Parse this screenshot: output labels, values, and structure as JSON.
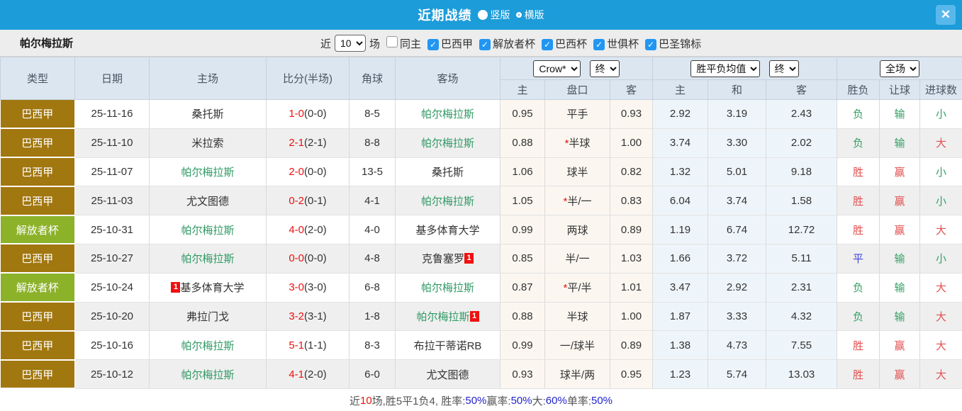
{
  "colors": {
    "header_blue": "#1c9cd9",
    "close_btn_blue": "#58b8ec",
    "checkbox_blue": "#2196f3",
    "type_gold": "#a1770f",
    "type_green": "#8cb22a",
    "team_green": "#2f9a64",
    "score_red": "#ee1111",
    "result_red": "#e25050",
    "result_green": "#35a065",
    "result_blue": "#4444dd",
    "footer_blue": "#2222cc",
    "header_row_bg": "#dce6f1",
    "handicap_col_bg": "#fbf7f0",
    "europe_col_bg": "#eef5fa",
    "alt_row_bg": "#efefef",
    "filter_bar_bg": "#ededed"
  },
  "header": {
    "title": "近期战绩",
    "vertical_label": "竖版",
    "horizontal_label": "横版",
    "close_label": "✕"
  },
  "filter": {
    "team": "帕尔梅拉斯",
    "recent_label": "近",
    "match_count": "10",
    "matches_label": "场",
    "check_glyph": "✓",
    "checkboxes": [
      {
        "label": "同主",
        "checked": false
      },
      {
        "label": "巴西甲",
        "checked": true
      },
      {
        "label": "解放者杯",
        "checked": true
      },
      {
        "label": "巴西杯",
        "checked": true
      },
      {
        "label": "世俱杯",
        "checked": true
      },
      {
        "label": "巴圣锦标",
        "checked": true
      }
    ]
  },
  "table": {
    "left_headers": [
      "类型",
      "日期",
      "主场",
      "比分(半场)",
      "角球",
      "客场"
    ],
    "selects": {
      "bookmaker": "Crow*",
      "handicap_period": "终",
      "europe_avg": "胜平负均值",
      "europe_period": "终",
      "scope": "全场"
    },
    "sub_headers": [
      "主",
      "盘口",
      "客",
      "主",
      "和",
      "客",
      "胜负",
      "让球",
      "进球数"
    ],
    "rows": [
      {
        "type": [
          "巴西甲",
          "gold"
        ],
        "date": "25-11-16",
        "home": {
          "name": "桑托斯",
          "green": false,
          "badge": null
        },
        "score": "1-0",
        "half": "(0-0)",
        "corners": "8-5",
        "away": {
          "name": "帕尔梅拉斯",
          "green": true,
          "badge": null
        },
        "ah": [
          "0.95",
          "平手",
          false,
          "0.93"
        ],
        "eu": [
          "2.92",
          "3.19",
          "2.43"
        ],
        "res": [
          [
            "负",
            "green"
          ],
          [
            "输",
            "green"
          ],
          [
            "小",
            "green"
          ]
        ]
      },
      {
        "type": [
          "巴西甲",
          "gold"
        ],
        "date": "25-11-10",
        "home": {
          "name": "米拉索",
          "green": false,
          "badge": null
        },
        "score": "2-1",
        "half": "(2-1)",
        "corners": "8-8",
        "away": {
          "name": "帕尔梅拉斯",
          "green": true,
          "badge": null
        },
        "ah": [
          "0.88",
          "半球",
          true,
          "1.00"
        ],
        "eu": [
          "3.74",
          "3.30",
          "2.02"
        ],
        "res": [
          [
            "负",
            "green"
          ],
          [
            "输",
            "green"
          ],
          [
            "大",
            "red"
          ]
        ]
      },
      {
        "type": [
          "巴西甲",
          "gold"
        ],
        "date": "25-11-07",
        "home": {
          "name": "帕尔梅拉斯",
          "green": true,
          "badge": null
        },
        "score": "2-0",
        "half": "(0-0)",
        "corners": "13-5",
        "away": {
          "name": "桑托斯",
          "green": false,
          "badge": null
        },
        "ah": [
          "1.06",
          "球半",
          false,
          "0.82"
        ],
        "eu": [
          "1.32",
          "5.01",
          "9.18"
        ],
        "res": [
          [
            "胜",
            "red"
          ],
          [
            "赢",
            "red"
          ],
          [
            "小",
            "green"
          ]
        ]
      },
      {
        "type": [
          "巴西甲",
          "gold"
        ],
        "date": "25-11-03",
        "home": {
          "name": "尤文图德",
          "green": false,
          "badge": null
        },
        "score": "0-2",
        "half": "(0-1)",
        "corners": "4-1",
        "away": {
          "name": "帕尔梅拉斯",
          "green": true,
          "badge": null
        },
        "ah": [
          "1.05",
          "半/一",
          true,
          "0.83"
        ],
        "eu": [
          "6.04",
          "3.74",
          "1.58"
        ],
        "res": [
          [
            "胜",
            "red"
          ],
          [
            "赢",
            "red"
          ],
          [
            "小",
            "green"
          ]
        ]
      },
      {
        "type": [
          "解放者杯",
          "green"
        ],
        "date": "25-10-31",
        "home": {
          "name": "帕尔梅拉斯",
          "green": true,
          "badge": null
        },
        "score": "4-0",
        "half": "(2-0)",
        "corners": "4-0",
        "away": {
          "name": "基多体育大学",
          "green": false,
          "badge": null
        },
        "ah": [
          "0.99",
          "两球",
          false,
          "0.89"
        ],
        "eu": [
          "1.19",
          "6.74",
          "12.72"
        ],
        "res": [
          [
            "胜",
            "red"
          ],
          [
            "赢",
            "red"
          ],
          [
            "大",
            "red"
          ]
        ]
      },
      {
        "type": [
          "巴西甲",
          "gold"
        ],
        "date": "25-10-27",
        "home": {
          "name": "帕尔梅拉斯",
          "green": true,
          "badge": null
        },
        "score": "0-0",
        "half": "(0-0)",
        "corners": "4-8",
        "away": {
          "name": "克鲁塞罗",
          "green": false,
          "badge": {
            "text": "1",
            "pos": "after"
          }
        },
        "ah": [
          "0.85",
          "半/一",
          false,
          "1.03"
        ],
        "eu": [
          "1.66",
          "3.72",
          "5.11"
        ],
        "res": [
          [
            "平",
            "blue"
          ],
          [
            "输",
            "green"
          ],
          [
            "小",
            "green"
          ]
        ]
      },
      {
        "type": [
          "解放者杯",
          "green"
        ],
        "date": "25-10-24",
        "home": {
          "name": "基多体育大学",
          "green": false,
          "badge": {
            "text": "1",
            "pos": "before"
          }
        },
        "score": "3-0",
        "half": "(3-0)",
        "corners": "6-8",
        "away": {
          "name": "帕尔梅拉斯",
          "green": true,
          "badge": null
        },
        "ah": [
          "0.87",
          "平/半",
          true,
          "1.01"
        ],
        "eu": [
          "3.47",
          "2.92",
          "2.31"
        ],
        "res": [
          [
            "负",
            "green"
          ],
          [
            "输",
            "green"
          ],
          [
            "大",
            "red"
          ]
        ]
      },
      {
        "type": [
          "巴西甲",
          "gold"
        ],
        "date": "25-10-20",
        "home": {
          "name": "弗拉门戈",
          "green": false,
          "badge": null
        },
        "score": "3-2",
        "half": "(3-1)",
        "corners": "1-8",
        "away": {
          "name": "帕尔梅拉斯",
          "green": true,
          "badge": {
            "text": "1",
            "pos": "after"
          }
        },
        "ah": [
          "0.88",
          "半球",
          false,
          "1.00"
        ],
        "eu": [
          "1.87",
          "3.33",
          "4.32"
        ],
        "res": [
          [
            "负",
            "green"
          ],
          [
            "输",
            "green"
          ],
          [
            "大",
            "red"
          ]
        ]
      },
      {
        "type": [
          "巴西甲",
          "gold"
        ],
        "date": "25-10-16",
        "home": {
          "name": "帕尔梅拉斯",
          "green": true,
          "badge": null
        },
        "score": "5-1",
        "half": "(1-1)",
        "corners": "8-3",
        "away": {
          "name": "布拉干蒂诺RB",
          "green": false,
          "badge": null
        },
        "ah": [
          "0.99",
          "一/球半",
          false,
          "0.89"
        ],
        "eu": [
          "1.38",
          "4.73",
          "7.55"
        ],
        "res": [
          [
            "胜",
            "red"
          ],
          [
            "赢",
            "red"
          ],
          [
            "大",
            "red"
          ]
        ]
      },
      {
        "type": [
          "巴西甲",
          "gold"
        ],
        "date": "25-10-12",
        "home": {
          "name": "帕尔梅拉斯",
          "green": true,
          "badge": null
        },
        "score": "4-1",
        "half": "(2-0)",
        "corners": "6-0",
        "away": {
          "name": "尤文图德",
          "green": false,
          "badge": null
        },
        "ah": [
          "0.93",
          "球半/两",
          false,
          "0.95"
        ],
        "eu": [
          "1.23",
          "5.74",
          "13.03"
        ],
        "res": [
          [
            "胜",
            "red"
          ],
          [
            "赢",
            "red"
          ],
          [
            "大",
            "red"
          ]
        ]
      }
    ]
  },
  "footer": {
    "segments": [
      [
        "近",
        "dark"
      ],
      [
        "10",
        "red"
      ],
      [
        "场,胜5平1负4, 胜率:",
        "dark"
      ],
      [
        "50%",
        "blue"
      ],
      [
        " 赢率:",
        "dark"
      ],
      [
        "50%",
        "blue"
      ],
      [
        " 大:",
        "dark"
      ],
      [
        "60%",
        "blue"
      ],
      [
        " 单率:",
        "dark"
      ],
      [
        "50%",
        "blue"
      ]
    ]
  }
}
